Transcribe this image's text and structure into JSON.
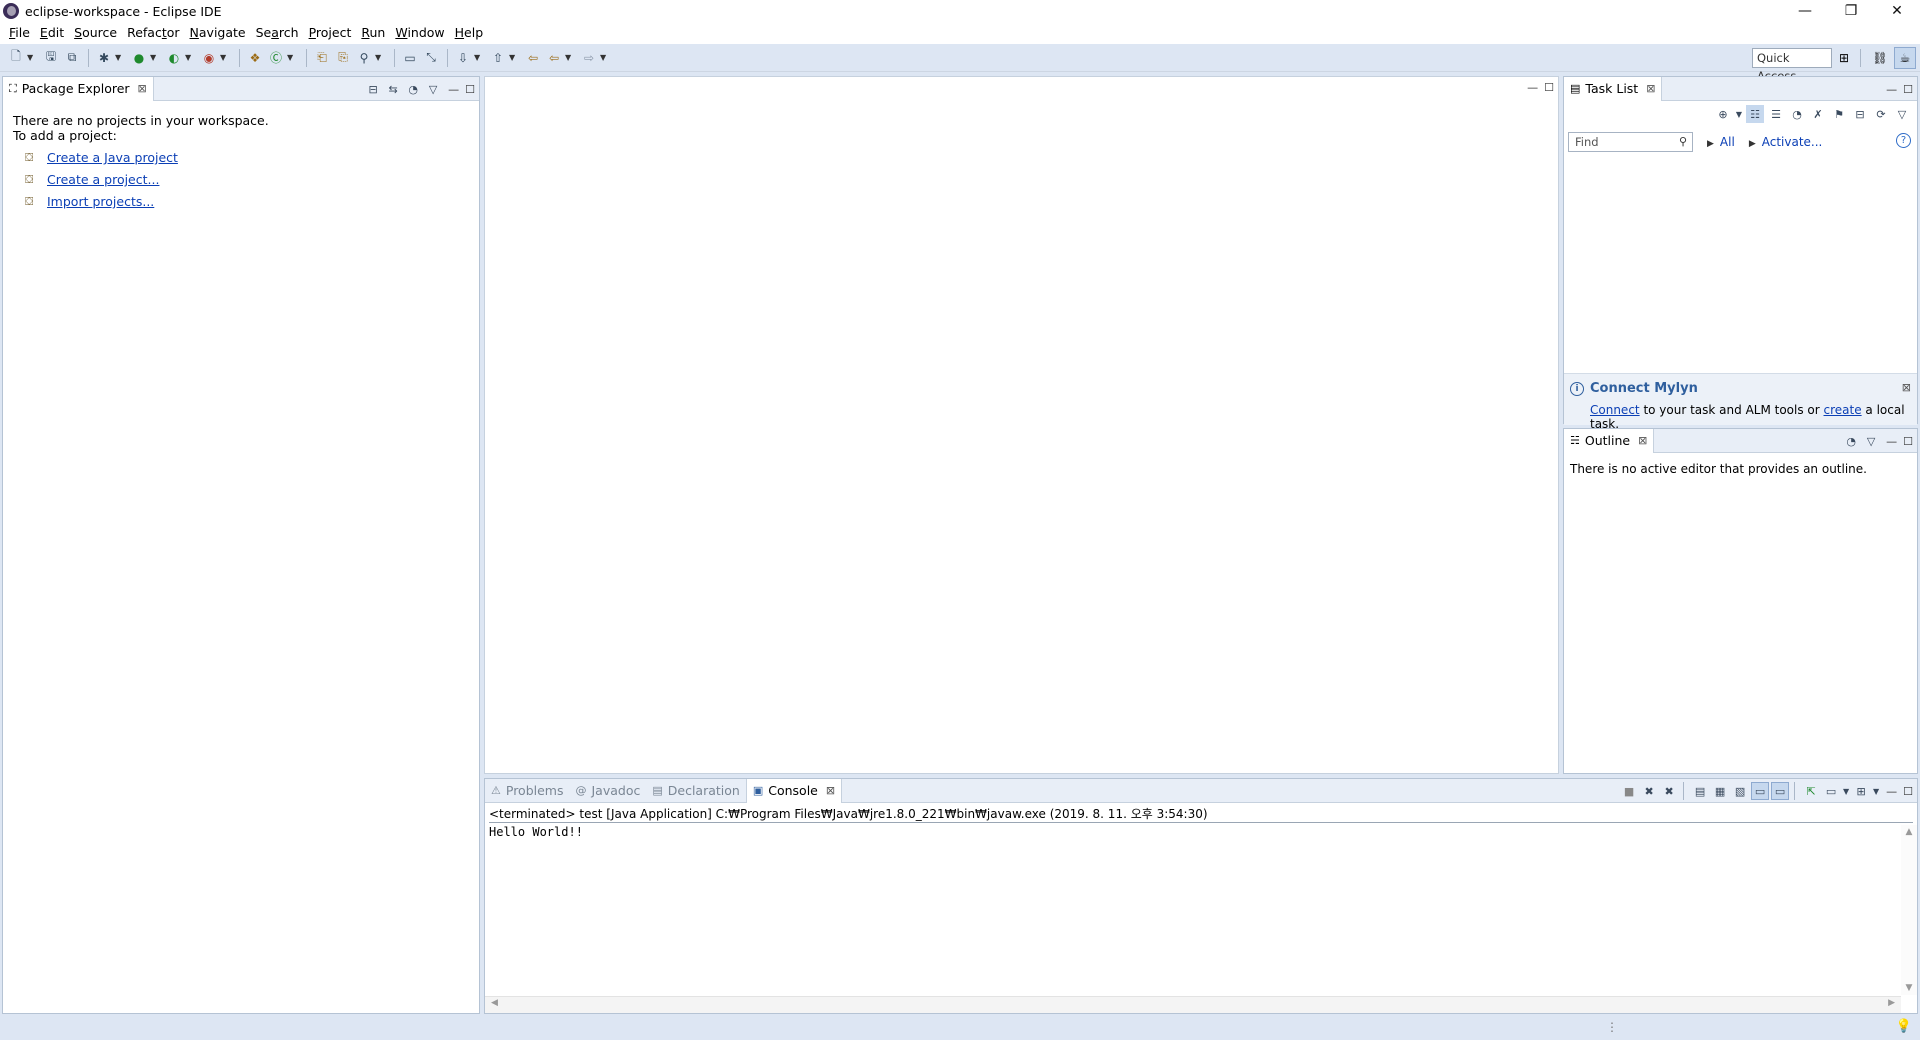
{
  "window": {
    "title": "eclipse-workspace - Eclipse IDE",
    "controls": [
      "—",
      "❐",
      "✕"
    ]
  },
  "menu": [
    {
      "u": "F",
      "rest": "ile"
    },
    {
      "u": "E",
      "rest": "dit"
    },
    {
      "u": "S",
      "rest": "ource"
    },
    {
      "u": "",
      "pre": "Refac",
      "ul": "t",
      "rest": "or"
    },
    {
      "u": "N",
      "rest": "avigate"
    },
    {
      "u": "",
      "pre": "Se",
      "ul": "a",
      "rest": "rch"
    },
    {
      "u": "P",
      "rest": "roject"
    },
    {
      "u": "R",
      "rest": "un"
    },
    {
      "u": "W",
      "rest": "indow"
    },
    {
      "u": "H",
      "rest": "elp"
    }
  ],
  "toolbar": {
    "quick_access_placeholder": "Quick Access"
  },
  "package_explorer": {
    "tab_label": "Package Explorer",
    "message_line1": "There are no projects in your workspace.",
    "message_line2": "To add a project:",
    "links": [
      {
        "label": "Create a Java project",
        "icon": "java-project-icon"
      },
      {
        "label": "Create a project...",
        "icon": "project-icon"
      },
      {
        "label": "Import projects...",
        "icon": "import-icon"
      }
    ]
  },
  "task_list": {
    "tab_label": "Task List",
    "find_placeholder": "Find",
    "filter_all": "All",
    "activate": "Activate...",
    "mylyn_title": "Connect Mylyn",
    "mylyn_connect": "Connect",
    "mylyn_middle": " to your task and ALM tools or ",
    "mylyn_create": "create",
    "mylyn_end": " a local task."
  },
  "outline": {
    "tab_label": "Outline",
    "message": "There is no active editor that provides an outline."
  },
  "bottom_tabs": [
    {
      "label": "Problems",
      "active": false
    },
    {
      "label": "Javadoc",
      "active": false
    },
    {
      "label": "Declaration",
      "active": false
    },
    {
      "label": "Console",
      "active": true
    }
  ],
  "console": {
    "status": "<terminated> test [Java Application] C:₩Program Files₩Java₩jre1.8.0_221₩bin₩javaw.exe (2019. 8. 11. 오후 3:54:30)",
    "output": "Hello World!!"
  }
}
